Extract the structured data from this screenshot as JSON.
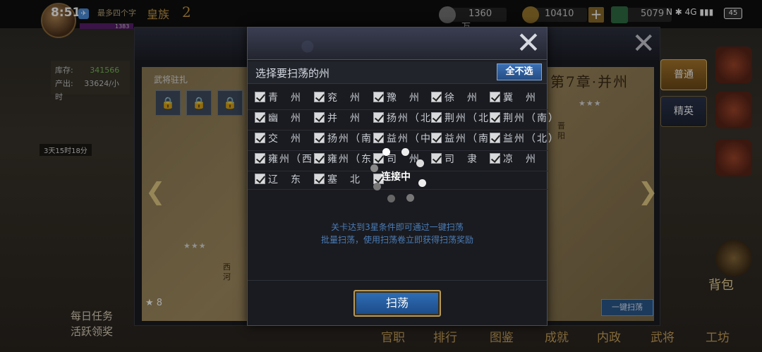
{
  "status_bar": {
    "time": "8:51",
    "battery": "45",
    "network": "4G"
  },
  "player": {
    "name": "最多四个字",
    "rank": "皇族",
    "level": "2",
    "exp": "1383"
  },
  "resources": {
    "silver": "1360万",
    "copper": "10410",
    "jade": "5079"
  },
  "left_panel": {
    "storage_label": "库存:",
    "storage_value": "341566",
    "output_label": "产出:",
    "output_value": "33624/小时",
    "timer": "3天15时18分",
    "daily_task": "每日任务",
    "activity_reward": "活跃领奖"
  },
  "map_window": {
    "garrison_label": "武将驻扎",
    "chapter_title": "第7章·并州",
    "tab_normal": "普通",
    "tab_elite": "精英",
    "sweep_all": "一键扫荡",
    "stars": "8",
    "stage_stars": "★★★",
    "city_jinyang": "晋阳",
    "city_xihe": "西河"
  },
  "bottom_nav": [
    "官职",
    "排行",
    "图鉴",
    "成就",
    "内政",
    "武将",
    "工坊"
  ],
  "right_menu": {
    "bag": "背包"
  },
  "dialog": {
    "title": "选择要扫荡的州",
    "deselect_all": "全不选",
    "regions": [
      {
        "label": "青　州",
        "checked": true
      },
      {
        "label": "兖　州",
        "checked": true
      },
      {
        "label": "豫　州",
        "checked": true
      },
      {
        "label": "徐　州",
        "checked": true
      },
      {
        "label": "冀　州",
        "checked": true
      },
      {
        "label": "幽　州",
        "checked": true
      },
      {
        "label": "并　州",
        "checked": true
      },
      {
        "label": "扬州（北）",
        "checked": true
      },
      {
        "label": "荆州（北）",
        "checked": true
      },
      {
        "label": "荆州（南）",
        "checked": true
      },
      {
        "label": "交　州",
        "checked": true
      },
      {
        "label": "扬州（南）",
        "checked": true
      },
      {
        "label": "益州（中）",
        "checked": true
      },
      {
        "label": "益州（南）",
        "checked": true
      },
      {
        "label": "益州（北）",
        "checked": true
      },
      {
        "label": "雍州（西）",
        "checked": true
      },
      {
        "label": "雍州（东）",
        "checked": true
      },
      {
        "label": "司　州",
        "checked": true
      },
      {
        "label": "司　隶",
        "checked": true
      },
      {
        "label": "凉　州",
        "checked": true
      },
      {
        "label": "辽　东",
        "checked": true
      },
      {
        "label": "塞　北",
        "checked": true
      },
      {
        "label": "",
        "checked": true
      }
    ],
    "hint_line1": "关卡达到3星条件即可通过一键扫荡",
    "hint_line2": "批量扫荡，使用扫荡卷立即获得扫荡奖励",
    "sweep_button": "扫荡"
  },
  "loading": {
    "text": "连接中"
  },
  "colors": {
    "accent_blue": "#2f6fb8",
    "hint_blue": "#4a7cb6",
    "gold_border": "#b69858"
  }
}
